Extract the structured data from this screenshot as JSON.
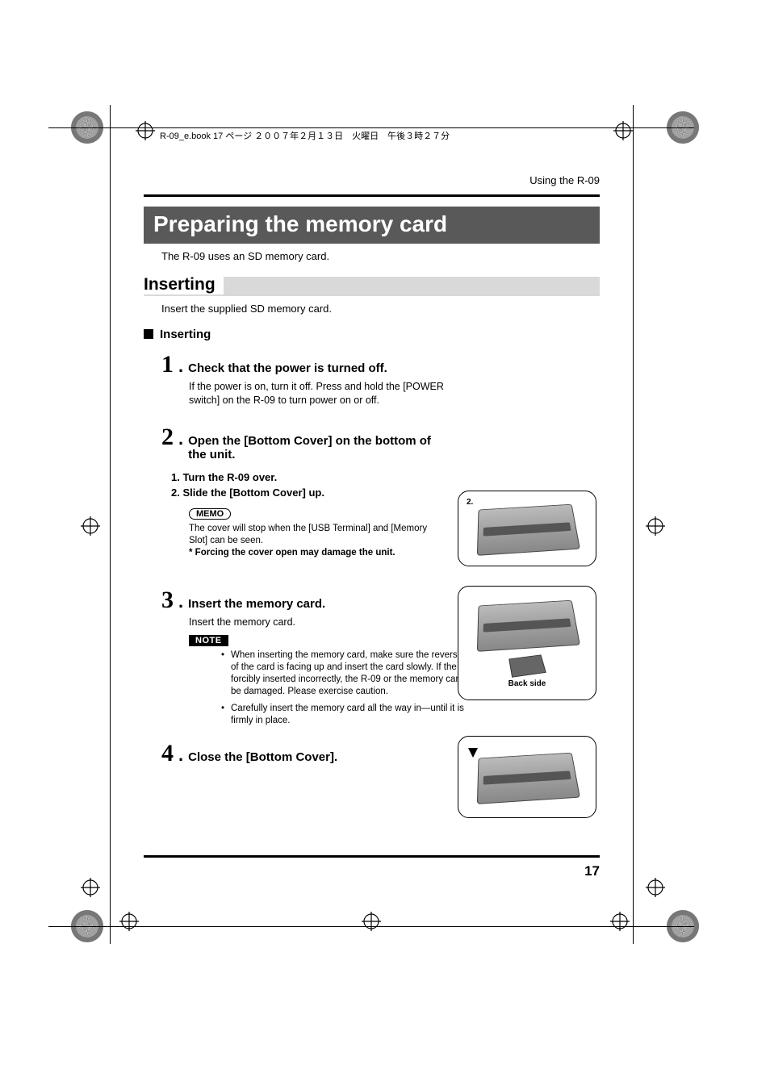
{
  "print_header": "R-09_e.book  17 ページ  ２００７年２月１３日　火曜日　午後３時２７分",
  "section_label": "Using the R-09",
  "title": "Preparing the memory card",
  "intro": "The R-09 uses an SD memory card.",
  "subhead": "Inserting",
  "subintro": "Insert the supplied SD memory card.",
  "bullet_head": "Inserting",
  "steps": {
    "s1": {
      "num": "1",
      "title": "Check that the power is turned off.",
      "body": "If the power is on, turn it off. Press and hold the [POWER switch] on the R-09 to turn power on or off."
    },
    "s2": {
      "num": "2",
      "title": "Open the [Bottom Cover] on the bottom of the unit.",
      "sub1": "1.  Turn the R-09 over.",
      "sub2": "2.  Slide the [Bottom Cover] up.",
      "memo_tag": "MEMO",
      "memo_body": "The cover will stop when the [USB Terminal] and [Memory Slot] can be seen.",
      "memo_warn": "* Forcing the cover open may damage the unit."
    },
    "s3": {
      "num": "3",
      "title": "Insert the memory card.",
      "body": "Insert the memory card.",
      "note_tag": "NOTE",
      "note1": "When inserting the memory card, make sure the reverse side of the card is facing up and insert the card slowly. If the card is forcibly inserted incorrectly, the R-09 or the memory card may be damaged. Please exercise caution.",
      "note2": "Carefully insert the memory card all the way in—until it is firmly in place."
    },
    "s4": {
      "num": "4",
      "title": "Close the [Bottom Cover]."
    }
  },
  "fig1_label": "2.",
  "fig2_backside": "Back side",
  "page_number": "17"
}
